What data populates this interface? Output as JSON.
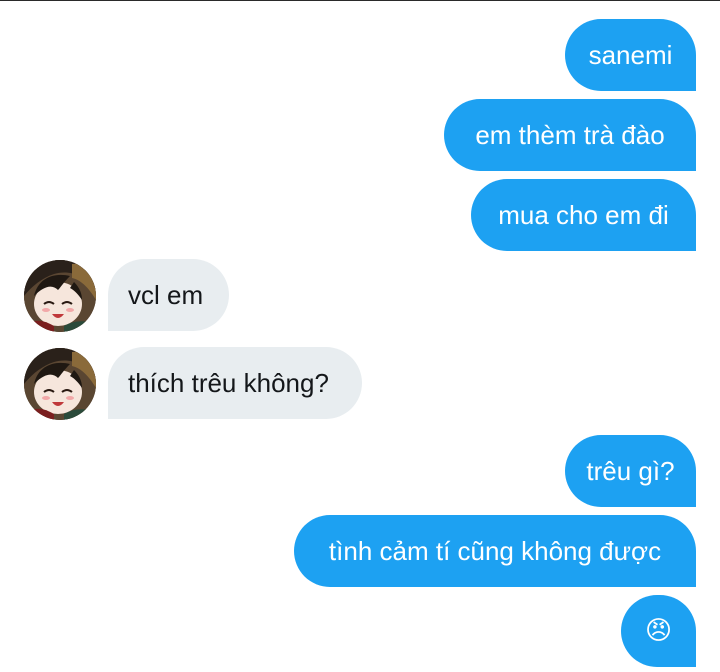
{
  "conversation": {
    "messages": [
      {
        "side": "sent",
        "text": "sanemi"
      },
      {
        "side": "sent",
        "text": "em thèm trà đào"
      },
      {
        "side": "sent",
        "text": "mua cho em đi"
      },
      {
        "side": "recv",
        "text": "vcl em",
        "avatar_icon": "anime-avatar-icon"
      },
      {
        "side": "recv",
        "text": "thích trêu không?",
        "avatar_icon": "anime-avatar-icon"
      },
      {
        "side": "sent",
        "text": "trêu gì?"
      },
      {
        "side": "sent",
        "text": "tình cảm tí cũng không được"
      },
      {
        "side": "sent",
        "text": "😠",
        "is_emoji": true,
        "icon": "angry-face-emoji"
      }
    ]
  },
  "colors": {
    "sent_bubble": "#1da1f2",
    "sent_text": "#ffffff",
    "recv_bubble": "#e8edf0",
    "recv_text": "#14171a",
    "background": "#ffffff"
  }
}
